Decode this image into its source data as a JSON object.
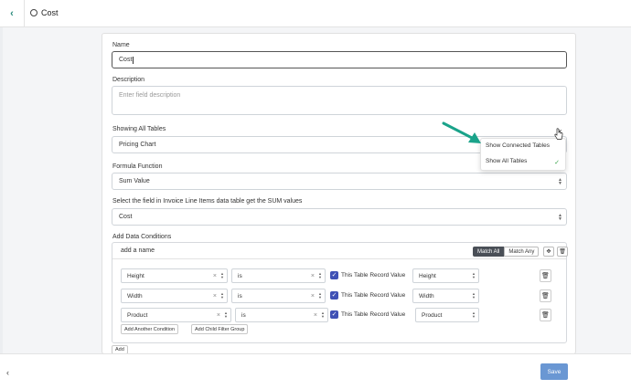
{
  "header": {
    "title": "Cost",
    "back_icon": "chevron-left-icon"
  },
  "form": {
    "name_label": "Name",
    "name_value": "Cost",
    "description_label": "Description",
    "description_placeholder": "Enter field description",
    "tables_label": "Showing All Tables",
    "tables_value": "Pricing Chart",
    "formula_label": "Formula Function",
    "formula_value": "Sum Value",
    "sum_field_label": "Select the field in Invoice Line Items data table get the SUM values",
    "sum_field_value": "Cost",
    "conditions_label": "Add Data Conditions"
  },
  "dropdown": {
    "items": [
      "Show Connected Tables",
      "Show All Tables"
    ],
    "selected": "Show All Tables"
  },
  "conditions": {
    "group_name": "add a name",
    "match_all": "Match All",
    "match_any": "Match Any",
    "rows": [
      {
        "field": "Height",
        "operator": "is",
        "record_label": "This Table Record Value",
        "value": "Height"
      },
      {
        "field": "Width",
        "operator": "is",
        "record_label": "This Table Record Value",
        "value": "Width"
      },
      {
        "field": "Product",
        "operator": "is",
        "record_label": "This Table Record Value",
        "value": "Product"
      }
    ],
    "add_condition": "Add Another Condition",
    "add_child_group": "Add Child Filter Group"
  },
  "add_button": "Add",
  "footer": {
    "save": "Save"
  },
  "colors": {
    "accent": "#3f51b5",
    "save": "#6a97d3",
    "arrow": "#1aa38a",
    "check": "#3aa34b"
  }
}
